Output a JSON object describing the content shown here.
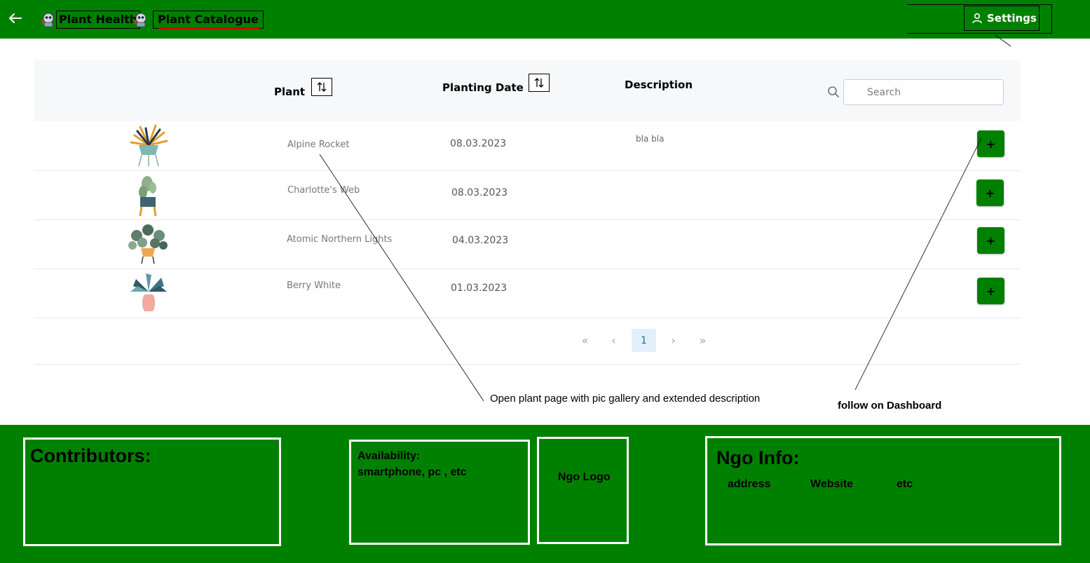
{
  "header": {
    "back_icon": "back-arrow-icon",
    "nav": [
      {
        "label": "Plant Health",
        "icon": "robot-icon"
      },
      {
        "label": "Plant Catalogue",
        "icon": "robot-icon",
        "active": true
      }
    ],
    "settings_label": "Settings",
    "settings_icon": "user-icon"
  },
  "table": {
    "columns": {
      "plant": "Plant",
      "planting_date": "Planting Date",
      "description": "Description"
    },
    "sort_icon": "sort-arrows-icon",
    "search_placeholder": "Search",
    "rows": [
      {
        "name": "Alpine Rocket",
        "date": "08.03.2023",
        "description": "bla bla",
        "image": "plant-icon",
        "action": "+"
      },
      {
        "name": "Charlotte's Web",
        "date": "08.03.2023",
        "description": "",
        "image": "cactus-icon",
        "action": "+"
      },
      {
        "name": "Atomic Northern Lights",
        "date": "04.03.2023",
        "description": "",
        "image": "pilea-icon",
        "action": "+"
      },
      {
        "name": "Berry White",
        "date": "01.03.2023",
        "description": "",
        "image": "vase-plant-icon",
        "action": "+"
      }
    ]
  },
  "pagination": {
    "first": "«",
    "prev": "‹",
    "current": "1",
    "next": "›",
    "last": "»"
  },
  "annotations": {
    "open_plant": "Open plant page with pic gallery and extended description",
    "follow": "follow on Dashboard"
  },
  "footer": {
    "contributors": "Contributors:",
    "availability_title": "Availability:",
    "availability_text": "smartphone, pc , etc",
    "ngo_logo": "Ngo Logo",
    "ngo_info_title": "Ngo Info:",
    "ngo_info_items": [
      "address",
      "Website",
      "etc"
    ]
  },
  "colors": {
    "brand_green": "#008000",
    "active_underline": "#d00000",
    "page_bg": "#ffffff"
  }
}
